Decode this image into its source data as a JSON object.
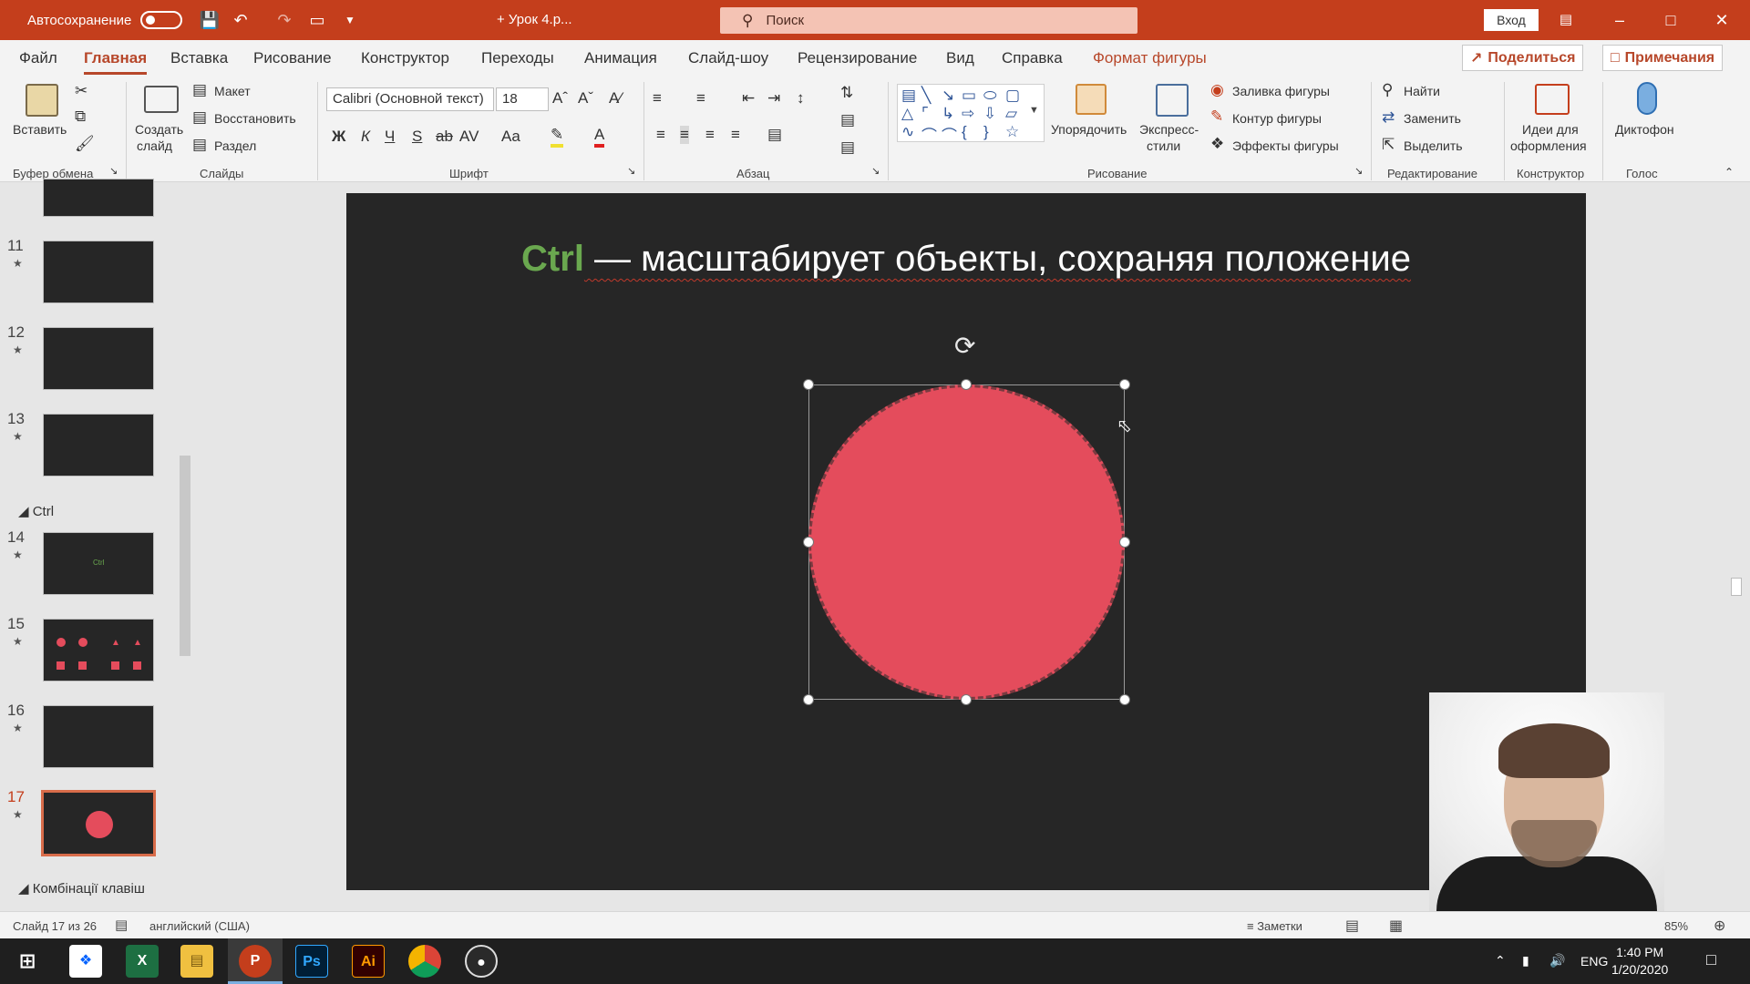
{
  "titlebar": {
    "autosave_label": "Автосохранение",
    "document_title": "+ Урок 4.р...",
    "search_placeholder": "Поиск",
    "login_label": "Вход",
    "accent_color": "#c43e1c"
  },
  "menu": {
    "tabs": [
      "Файл",
      "Главная",
      "Вставка",
      "Рисование",
      "Конструктор",
      "Переходы",
      "Анимация",
      "Слайд-шоу",
      "Рецензирование",
      "Вид",
      "Справка",
      "Формат фигуры"
    ],
    "active_tab": "Главная",
    "share_label": "Поделиться",
    "notes_label": "Примечания"
  },
  "ribbon": {
    "clipboard": {
      "paste_label": "Вставить",
      "group_label": "Буфер обмена"
    },
    "slides": {
      "create_label_1": "Создать",
      "create_label_2": "слайд",
      "layout_label": "Макет",
      "reset_label": "Восстановить",
      "section_label": "Раздел",
      "group_label": "Слайды"
    },
    "font": {
      "font_name": "Calibri (Основной текст)",
      "font_size": "18",
      "bold": "Ж",
      "italic": "К",
      "underline": "Ч",
      "strike": "S",
      "case": "Aa",
      "group_label": "Шрифт"
    },
    "paragraph": {
      "group_label": "Абзац"
    },
    "drawing": {
      "arrange_label": "Упорядочить",
      "quick_styles_1": "Экспресс-",
      "quick_styles_2": "стили",
      "fill_label": "Заливка фигуры",
      "outline_label": "Контур фигуры",
      "effects_label": "Эффекты фигуры",
      "group_label": "Рисование"
    },
    "editing": {
      "find_label": "Найти",
      "replace_label": "Заменить",
      "select_label": "Выделить",
      "group_label": "Редактирование"
    },
    "designer": {
      "ideas_label_1": "Идеи для",
      "ideas_label_2": "оформления",
      "group_label": "Конструктор"
    },
    "voice": {
      "dictate_label": "Диктофон",
      "group_label": "Голос"
    }
  },
  "thumbnails": {
    "slides": [
      {
        "num": "11"
      },
      {
        "num": "12"
      },
      {
        "num": "13"
      },
      {
        "num": "14",
        "text": "Ctrl"
      },
      {
        "num": "15"
      },
      {
        "num": "16"
      },
      {
        "num": "17"
      }
    ],
    "sections": [
      "Ctrl",
      "Комбінації клавіш"
    ],
    "selected": "17"
  },
  "slide": {
    "title_key": "Ctrl",
    "title_rest": " — масштабирует объекты, сохраняя положение",
    "shape_color": "#e44c5c",
    "background": "#262626"
  },
  "statusbar": {
    "slide_info": "Слайд 17 из 26",
    "language": "английский (США)",
    "notes_label": "Заметки",
    "zoom": "85%"
  },
  "taskbar": {
    "language": "ENG",
    "time": "1:40 PM",
    "date": "1/20/2020",
    "apps": [
      "dropbox-icon",
      "excel-icon",
      "explorer-icon",
      "powerpoint-icon",
      "photoshop-icon",
      "illustrator-icon",
      "chrome-icon",
      "obs-icon"
    ]
  }
}
